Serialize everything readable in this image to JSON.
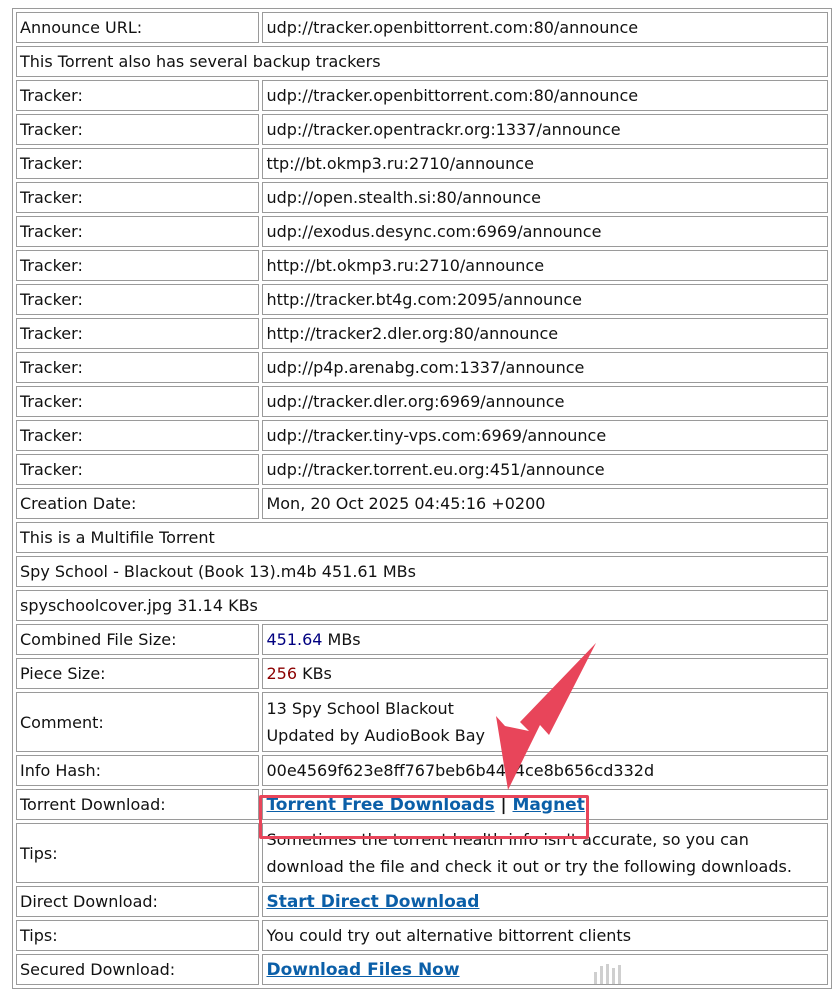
{
  "announce": {
    "label": "Announce URL:",
    "value": "udp://tracker.openbittorrent.com:80/announce"
  },
  "backup_note": "This Torrent also has several backup trackers",
  "trackers": [
    {
      "label": "Tracker:",
      "value": "udp://tracker.openbittorrent.com:80/announce"
    },
    {
      "label": "Tracker:",
      "value": "udp://tracker.opentrackr.org:1337/announce"
    },
    {
      "label": "Tracker:",
      "value": "ttp://bt.okmp3.ru:2710/announce"
    },
    {
      "label": "Tracker:",
      "value": "udp://open.stealth.si:80/announce"
    },
    {
      "label": "Tracker:",
      "value": "udp://exodus.desync.com:6969/announce"
    },
    {
      "label": "Tracker:",
      "value": "http://bt.okmp3.ru:2710/announce"
    },
    {
      "label": "Tracker:",
      "value": "http://tracker.bt4g.com:2095/announce"
    },
    {
      "label": "Tracker:",
      "value": "http://tracker2.dler.org:80/announce"
    },
    {
      "label": "Tracker:",
      "value": "udp://p4p.arenabg.com:1337/announce"
    },
    {
      "label": "Tracker:",
      "value": "udp://tracker.dler.org:6969/announce"
    },
    {
      "label": "Tracker:",
      "value": "udp://tracker.tiny-vps.com:6969/announce"
    },
    {
      "label": "Tracker:",
      "value": "udp://tracker.torrent.eu.org:451/announce"
    }
  ],
  "creation": {
    "label": "Creation Date:",
    "value": "Mon, 20 Oct 2025 04:45:16 +0200"
  },
  "multifile_note": "This is a Multifile Torrent",
  "files": [
    "Spy School - Blackout (Book 13).m4b 451.61 MBs",
    "spyschoolcover.jpg 31.14 KBs"
  ],
  "combined_size": {
    "label": "Combined File Size:",
    "number": "451.64",
    "unit": " MBs"
  },
  "piece_size": {
    "label": "Piece Size:",
    "number": "256",
    "unit": " KBs"
  },
  "comment": {
    "label": "Comment:",
    "line1": "13 Spy School Blackout",
    "line2": "Updated by AudioBook Bay"
  },
  "info_hash": {
    "label": "Info Hash:",
    "value": "00e4569f623e8ff767beb6b44c4ce8b656cd332d"
  },
  "torrent_download": {
    "label": "Torrent Download:",
    "link1": "Torrent Free Downloads",
    "separator": "|",
    "link2": "Magnet"
  },
  "tips1": {
    "label": "Tips:",
    "value": "Sometimes the torrent health info isn't accurate, so you can download the file and check it out or try the following downloads."
  },
  "direct_download": {
    "label": "Direct Download:",
    "link": "Start Direct Download"
  },
  "tips2": {
    "label": "Tips:",
    "value": "You could try out alternative bittorrent clients"
  },
  "secured_download": {
    "label": "Secured Download:",
    "link": "Download Files Now"
  },
  "colors": {
    "highlight": "#e8455a",
    "link": "#0b5fa8",
    "size_number": "#000080",
    "piece_number": "#8b0000"
  },
  "icons": {
    "annotation_arrow": "arrow-pointer-icon",
    "watermark": "watermark-icon"
  }
}
